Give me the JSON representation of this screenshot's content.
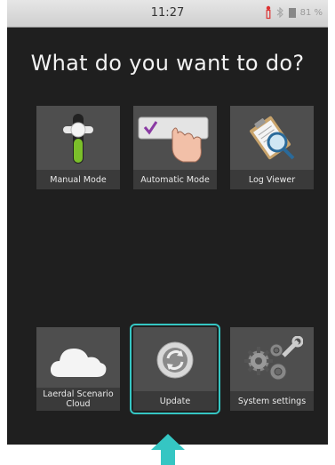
{
  "status_bar": {
    "time": "11:27",
    "battery": "81 %"
  },
  "heading": "What do you want to do?",
  "tiles": [
    {
      "label": "Manual Mode",
      "icon": "slider-icon"
    },
    {
      "label": "Automatic Mode",
      "icon": "touch-check-icon"
    },
    {
      "label": "Log Viewer",
      "icon": "magnifier-clipboard-icon"
    },
    {
      "label_line1": "Laerdal Scenario",
      "label_line2": "Cloud",
      "icon": "cloud-icon"
    },
    {
      "label": "Update",
      "icon": "refresh-icon"
    },
    {
      "label": "System settings",
      "icon": "gears-wrench-icon"
    }
  ],
  "colors": {
    "screen": "#1f1f1f",
    "tile": "#4e4e4e",
    "selection": "#35c6c3"
  }
}
